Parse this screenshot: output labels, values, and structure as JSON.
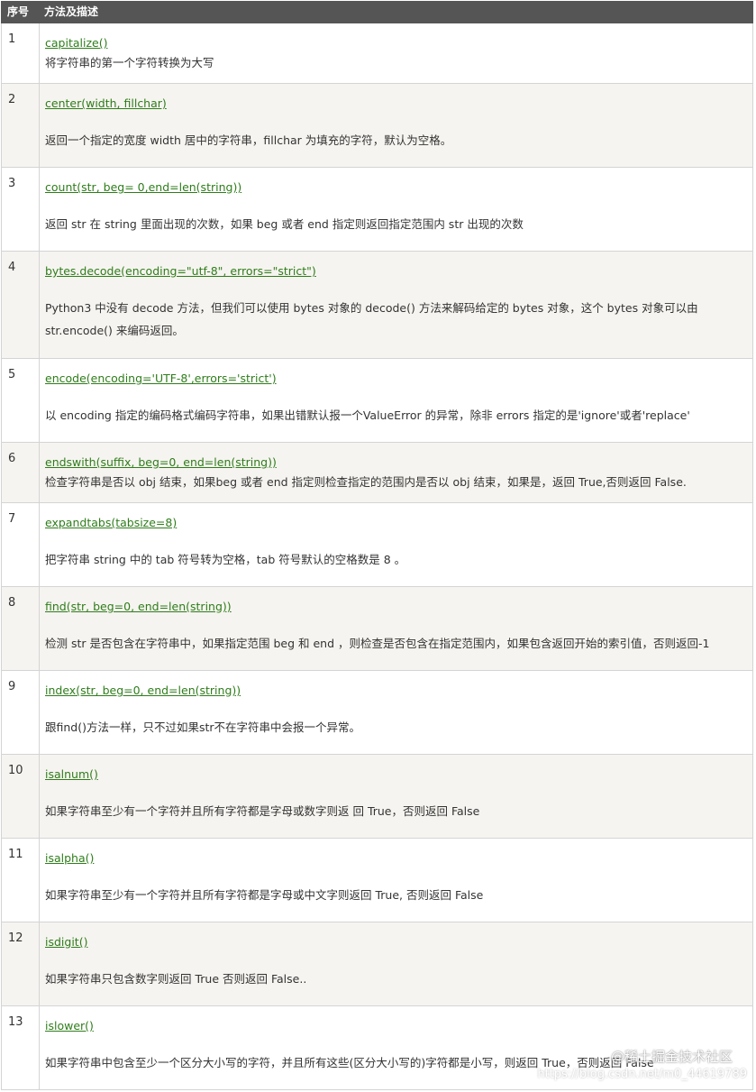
{
  "header": {
    "col_num": "序号",
    "col_desc": "方法及描述"
  },
  "rows": [
    {
      "num": "1",
      "method": "capitalize()",
      "desc": "将字符串的第一个字符转换为大写"
    },
    {
      "num": "2",
      "method": "center(width, fillchar)",
      "desc": "返回一个指定的宽度 width 居中的字符串，fillchar 为填充的字符，默认为空格。"
    },
    {
      "num": "3",
      "method": "count(str, beg= 0,end=len(string))",
      "desc": "返回 str 在 string 里面出现的次数，如果 beg 或者 end 指定则返回指定范围内 str 出现的次数"
    },
    {
      "num": "4",
      "method": "bytes.decode(encoding=\"utf-8\", errors=\"strict\")",
      "desc_1": "Python3 中没有 decode 方法，但我们可以使用 bytes 对象的 decode() 方法来解码给定的 bytes 对象，这个 bytes 对象可以由",
      "desc_2": "str.encode() 来编码返回。"
    },
    {
      "num": "5",
      "method": "encode(encoding='UTF-8',errors='strict')",
      "desc": "以 encoding 指定的编码格式编码字符串，如果出错默认报一个ValueError 的异常，除非 errors 指定的是'ignore'或者'replace'"
    },
    {
      "num": "6",
      "method": "endswith(suffix, beg=0, end=len(string))",
      "desc": "检查字符串是否以 obj 结束，如果beg 或者 end 指定则检查指定的范围内是否以 obj 结束，如果是，返回 True,否则返回 False."
    },
    {
      "num": "7",
      "method": "expandtabs(tabsize=8)",
      "desc": "把字符串 string 中的 tab 符号转为空格，tab 符号默认的空格数是 8 。"
    },
    {
      "num": "8",
      "method": "find(str, beg=0, end=len(string))",
      "desc": "检测 str 是否包含在字符串中，如果指定范围 beg 和 end ，则检查是否包含在指定范围内，如果包含返回开始的索引值，否则返回-1"
    },
    {
      "num": "9",
      "method": "index(str, beg=0, end=len(string))",
      "desc": "跟find()方法一样，只不过如果str不在字符串中会报一个异常。"
    },
    {
      "num": "10",
      "method": "isalnum()",
      "desc": "如果字符串至少有一个字符并且所有字符都是字母或数字则返 回 True，否则返回 False"
    },
    {
      "num": "11",
      "method": "isalpha()",
      "desc": "如果字符串至少有一个字符并且所有字符都是字母或中文字则返回 True, 否则返回 False"
    },
    {
      "num": "12",
      "method": "isdigit()",
      "desc": "如果字符串只包含数字则返回 True 否则返回 False.."
    },
    {
      "num": "13",
      "method": "islower()",
      "desc": "如果字符串中包含至少一个区分大小写的字符，并且所有这些(区分大小写的)字符都是小写，则返回 True，否则返回 False"
    }
  ],
  "watermark": {
    "line1": "@稀土掘金技术社区",
    "line2": "https://blog.csdn.net/m0_44619789"
  }
}
